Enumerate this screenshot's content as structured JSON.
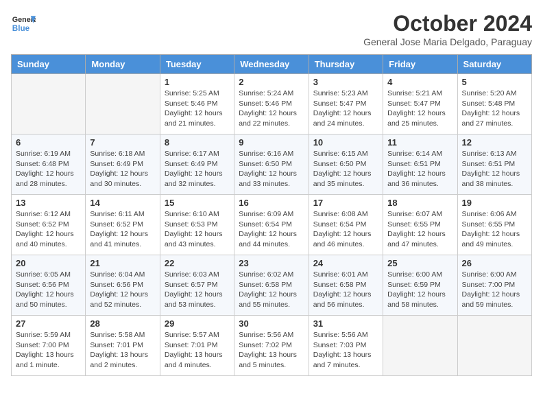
{
  "header": {
    "logo_line1": "General",
    "logo_line2": "Blue",
    "month_title": "October 2024",
    "subtitle": "General Jose Maria Delgado, Paraguay"
  },
  "days_of_week": [
    "Sunday",
    "Monday",
    "Tuesday",
    "Wednesday",
    "Thursday",
    "Friday",
    "Saturday"
  ],
  "weeks": [
    [
      {
        "day": "",
        "info": ""
      },
      {
        "day": "",
        "info": ""
      },
      {
        "day": "1",
        "info": "Sunrise: 5:25 AM\nSunset: 5:46 PM\nDaylight: 12 hours and 21 minutes."
      },
      {
        "day": "2",
        "info": "Sunrise: 5:24 AM\nSunset: 5:46 PM\nDaylight: 12 hours and 22 minutes."
      },
      {
        "day": "3",
        "info": "Sunrise: 5:23 AM\nSunset: 5:47 PM\nDaylight: 12 hours and 24 minutes."
      },
      {
        "day": "4",
        "info": "Sunrise: 5:21 AM\nSunset: 5:47 PM\nDaylight: 12 hours and 25 minutes."
      },
      {
        "day": "5",
        "info": "Sunrise: 5:20 AM\nSunset: 5:48 PM\nDaylight: 12 hours and 27 minutes."
      }
    ],
    [
      {
        "day": "6",
        "info": "Sunrise: 6:19 AM\nSunset: 6:48 PM\nDaylight: 12 hours and 28 minutes."
      },
      {
        "day": "7",
        "info": "Sunrise: 6:18 AM\nSunset: 6:49 PM\nDaylight: 12 hours and 30 minutes."
      },
      {
        "day": "8",
        "info": "Sunrise: 6:17 AM\nSunset: 6:49 PM\nDaylight: 12 hours and 32 minutes."
      },
      {
        "day": "9",
        "info": "Sunrise: 6:16 AM\nSunset: 6:50 PM\nDaylight: 12 hours and 33 minutes."
      },
      {
        "day": "10",
        "info": "Sunrise: 6:15 AM\nSunset: 6:50 PM\nDaylight: 12 hours and 35 minutes."
      },
      {
        "day": "11",
        "info": "Sunrise: 6:14 AM\nSunset: 6:51 PM\nDaylight: 12 hours and 36 minutes."
      },
      {
        "day": "12",
        "info": "Sunrise: 6:13 AM\nSunset: 6:51 PM\nDaylight: 12 hours and 38 minutes."
      }
    ],
    [
      {
        "day": "13",
        "info": "Sunrise: 6:12 AM\nSunset: 6:52 PM\nDaylight: 12 hours and 40 minutes."
      },
      {
        "day": "14",
        "info": "Sunrise: 6:11 AM\nSunset: 6:52 PM\nDaylight: 12 hours and 41 minutes."
      },
      {
        "day": "15",
        "info": "Sunrise: 6:10 AM\nSunset: 6:53 PM\nDaylight: 12 hours and 43 minutes."
      },
      {
        "day": "16",
        "info": "Sunrise: 6:09 AM\nSunset: 6:54 PM\nDaylight: 12 hours and 44 minutes."
      },
      {
        "day": "17",
        "info": "Sunrise: 6:08 AM\nSunset: 6:54 PM\nDaylight: 12 hours and 46 minutes."
      },
      {
        "day": "18",
        "info": "Sunrise: 6:07 AM\nSunset: 6:55 PM\nDaylight: 12 hours and 47 minutes."
      },
      {
        "day": "19",
        "info": "Sunrise: 6:06 AM\nSunset: 6:55 PM\nDaylight: 12 hours and 49 minutes."
      }
    ],
    [
      {
        "day": "20",
        "info": "Sunrise: 6:05 AM\nSunset: 6:56 PM\nDaylight: 12 hours and 50 minutes."
      },
      {
        "day": "21",
        "info": "Sunrise: 6:04 AM\nSunset: 6:56 PM\nDaylight: 12 hours and 52 minutes."
      },
      {
        "day": "22",
        "info": "Sunrise: 6:03 AM\nSunset: 6:57 PM\nDaylight: 12 hours and 53 minutes."
      },
      {
        "day": "23",
        "info": "Sunrise: 6:02 AM\nSunset: 6:58 PM\nDaylight: 12 hours and 55 minutes."
      },
      {
        "day": "24",
        "info": "Sunrise: 6:01 AM\nSunset: 6:58 PM\nDaylight: 12 hours and 56 minutes."
      },
      {
        "day": "25",
        "info": "Sunrise: 6:00 AM\nSunset: 6:59 PM\nDaylight: 12 hours and 58 minutes."
      },
      {
        "day": "26",
        "info": "Sunrise: 6:00 AM\nSunset: 7:00 PM\nDaylight: 12 hours and 59 minutes."
      }
    ],
    [
      {
        "day": "27",
        "info": "Sunrise: 5:59 AM\nSunset: 7:00 PM\nDaylight: 13 hours and 1 minute."
      },
      {
        "day": "28",
        "info": "Sunrise: 5:58 AM\nSunset: 7:01 PM\nDaylight: 13 hours and 2 minutes."
      },
      {
        "day": "29",
        "info": "Sunrise: 5:57 AM\nSunset: 7:01 PM\nDaylight: 13 hours and 4 minutes."
      },
      {
        "day": "30",
        "info": "Sunrise: 5:56 AM\nSunset: 7:02 PM\nDaylight: 13 hours and 5 minutes."
      },
      {
        "day": "31",
        "info": "Sunrise: 5:56 AM\nSunset: 7:03 PM\nDaylight: 13 hours and 7 minutes."
      },
      {
        "day": "",
        "info": ""
      },
      {
        "day": "",
        "info": ""
      }
    ]
  ]
}
